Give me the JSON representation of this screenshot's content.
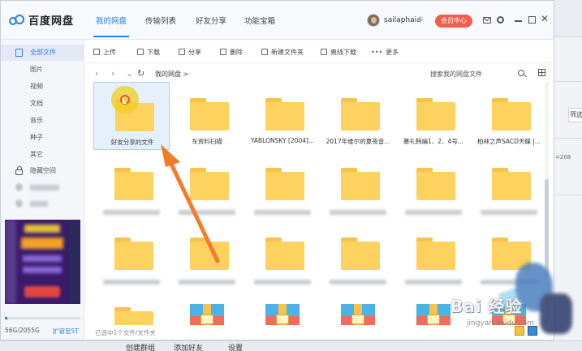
{
  "app": {
    "title": "百度网盘",
    "nav_tabs": [
      {
        "label": "我的网盘",
        "active": true
      },
      {
        "label": "传输列表",
        "active": false
      },
      {
        "label": "好友分享",
        "active": false
      },
      {
        "label": "功能宝箱",
        "active": false
      }
    ],
    "username": "sailaphaia",
    "vip_label": "会员中心"
  },
  "sidebar": {
    "items": [
      {
        "label": "全部文件",
        "active": true,
        "icon": "all-files-icon"
      },
      {
        "label": "图片"
      },
      {
        "label": "视频"
      },
      {
        "label": "文档"
      },
      {
        "label": "音乐"
      },
      {
        "label": "种子"
      },
      {
        "label": "其它"
      },
      {
        "label": "隐藏空间",
        "icon": "lock-icon"
      }
    ],
    "quota_text": "56G/2055G",
    "quota_fraction": 0.027,
    "expand_label": "扩容至5T"
  },
  "toolbar": {
    "items": [
      {
        "label": "上传",
        "icon": "upload-icon"
      },
      {
        "label": "下载",
        "icon": "download-icon"
      },
      {
        "label": "分享",
        "icon": "share-icon"
      },
      {
        "label": "删除",
        "icon": "delete-icon"
      },
      {
        "label": "新建文件夹",
        "icon": "new-folder-icon"
      },
      {
        "label": "离线下载",
        "icon": "offline-download-icon"
      },
      {
        "label": "更多",
        "icon": "more-icon"
      }
    ],
    "more_dots": "•••"
  },
  "breadcrumb": {
    "back": "‹",
    "forward": "›",
    "refresh": "↻",
    "path": "我的网盘",
    "separator": ">",
    "search_placeholder": "搜索我的网盘文件"
  },
  "files_row1": [
    {
      "name": "好友分享的文件",
      "selected": true
    },
    {
      "name": "车资料扫描"
    },
    {
      "name": "YABLONSKY [2004]..."
    },
    {
      "name": "2017年维尔的夏夜音..."
    },
    {
      "name": "慕礼韩编1、2、4号..."
    },
    {
      "name": "柏林之声SACD天碟 |..."
    }
  ],
  "status": {
    "text": "已选中1个文件/文件夹"
  },
  "background": {
    "filter_label": "筛选",
    "number": "=208",
    "taskbar": [
      "创建群组",
      "添加好友",
      "设置"
    ]
  },
  "watermark": {
    "text": "Bai 经验",
    "url": "jingyan.baidu.com"
  }
}
